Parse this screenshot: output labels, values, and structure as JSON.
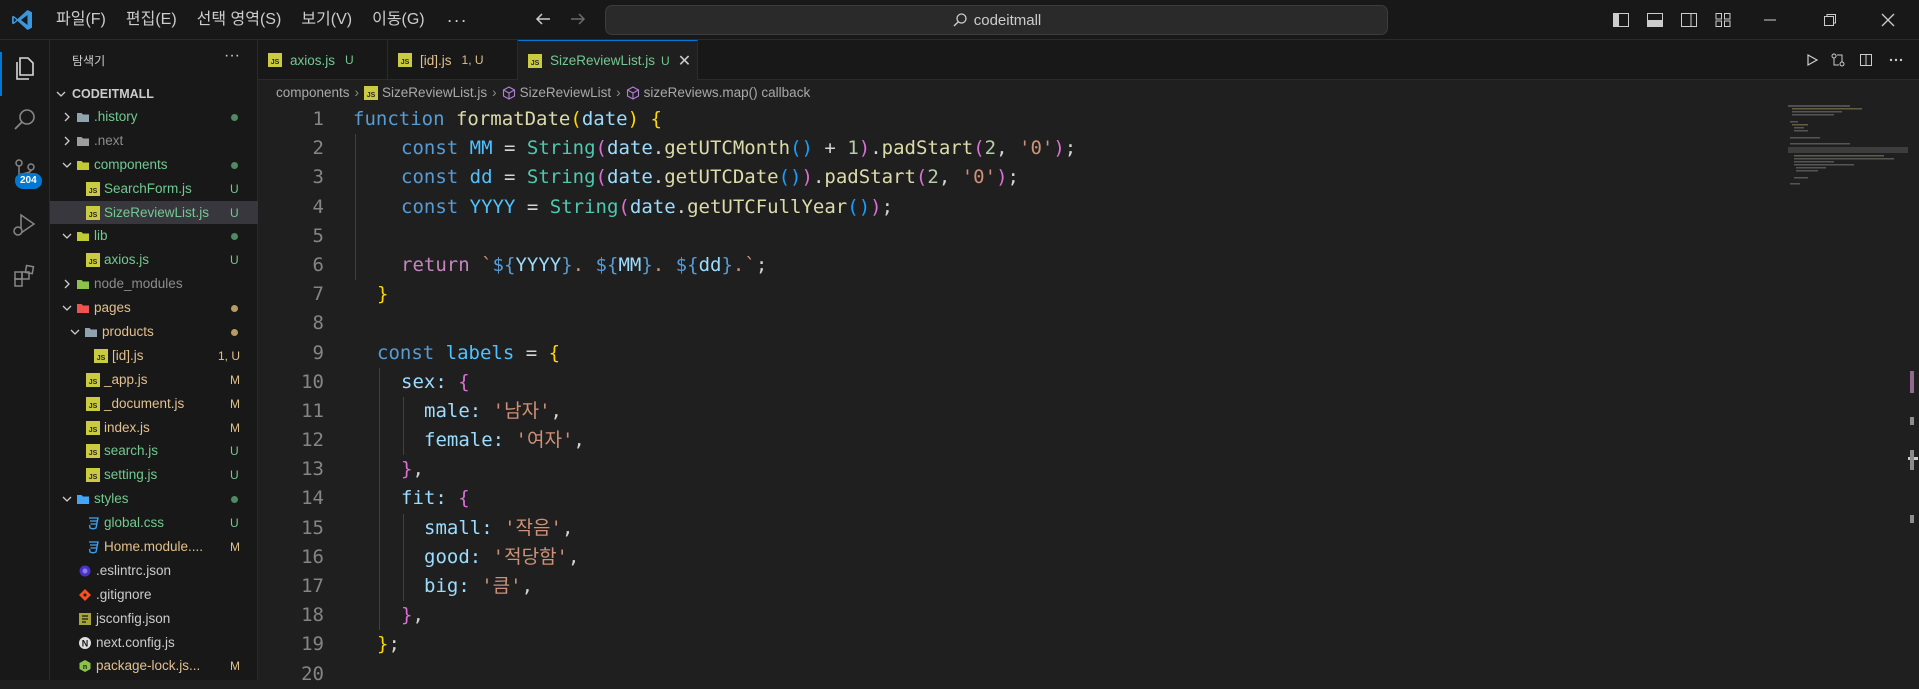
{
  "menu": [
    "파일(F)",
    "편집(E)",
    "선택 영역(S)",
    "보기(V)",
    "이동(G)"
  ],
  "menu_more": "···",
  "search": {
    "text": "codeitmall"
  },
  "activity": {
    "scm_badge": "204"
  },
  "explorer": {
    "title": "탐색기",
    "more": "···",
    "root": "CODEITMALL",
    "items": [
      {
        "name": ".history",
        "type": "folder",
        "status": "",
        "color": "green",
        "dot": true
      },
      {
        "name": ".next",
        "type": "folder",
        "status": "",
        "color": "gray",
        "dot": false
      },
      {
        "name": "components",
        "type": "folder",
        "status": "",
        "color": "green",
        "dot": true
      },
      {
        "name": "SearchForm.js",
        "type": "js",
        "status": "U",
        "color": "green",
        "dot": false
      },
      {
        "name": "SizeReviewList.js",
        "type": "js",
        "status": "U",
        "color": "green",
        "dot": false
      },
      {
        "name": "lib",
        "type": "folder",
        "status": "",
        "color": "green",
        "dot": true
      },
      {
        "name": "axios.js",
        "type": "js",
        "status": "U",
        "color": "green",
        "dot": false
      },
      {
        "name": "node_modules",
        "type": "folder",
        "status": "",
        "color": "gray",
        "dot": false
      },
      {
        "name": "pages",
        "type": "folder",
        "status": "",
        "color": "gold",
        "dot": true
      },
      {
        "name": "products",
        "type": "folder",
        "status": "",
        "color": "gold",
        "dot": true
      },
      {
        "name": "[id].js",
        "type": "js",
        "status": "1, U",
        "color": "gold",
        "dot": false
      },
      {
        "name": "_app.js",
        "type": "js",
        "status": "M",
        "color": "gold",
        "dot": false
      },
      {
        "name": "_document.js",
        "type": "js",
        "status": "M",
        "color": "gold",
        "dot": false
      },
      {
        "name": "index.js",
        "type": "js",
        "status": "M",
        "color": "gold",
        "dot": false
      },
      {
        "name": "search.js",
        "type": "js",
        "status": "U",
        "color": "green",
        "dot": false
      },
      {
        "name": "setting.js",
        "type": "js",
        "status": "U",
        "color": "green",
        "dot": false
      },
      {
        "name": "styles",
        "type": "folder",
        "status": "",
        "color": "green",
        "dot": true
      },
      {
        "name": "global.css",
        "type": "css",
        "status": "U",
        "color": "green",
        "dot": false
      },
      {
        "name": "Home.module....",
        "type": "css",
        "status": "M",
        "color": "gold",
        "dot": false
      },
      {
        "name": ".eslintrc.json",
        "type": "eslint",
        "status": "",
        "color": "default",
        "dot": false
      },
      {
        "name": ".gitignore",
        "type": "git",
        "status": "",
        "color": "default",
        "dot": false
      },
      {
        "name": "jsconfig.json",
        "type": "jsconfig",
        "status": "",
        "color": "default",
        "dot": false
      },
      {
        "name": "next.config.js",
        "type": "next",
        "status": "",
        "color": "default",
        "dot": false
      },
      {
        "name": "package-lock.js...",
        "type": "npm",
        "status": "M",
        "color": "gold",
        "dot": false
      }
    ]
  },
  "tabs": [
    {
      "label": "axios.js",
      "status": "U"
    },
    {
      "label": "[id].js",
      "status": "1, U"
    },
    {
      "label": "SizeReviewList.js",
      "status": "U",
      "close": "✕"
    }
  ],
  "breadcrumb": {
    "folder": "components",
    "file": "SizeReviewList.js",
    "symbol": "SizeReviewList",
    "callback": "sizeReviews.map() callback",
    "sep": "›"
  },
  "code": {
    "line_numbers": [
      "1",
      "2",
      "3",
      "4",
      "5",
      "6",
      "7",
      "8",
      "9",
      "10",
      "11",
      "12",
      "13",
      "14",
      "15",
      "16",
      "17",
      "18",
      "19",
      "20"
    ],
    "line1": {
      "kw": "function",
      "fn": "formatDate",
      "p": "(",
      "param": "date",
      "pc": ")",
      "brace": "{"
    },
    "line2": {
      "kw": "const",
      "name": "MM",
      "eq": "=",
      "cls": "String",
      "po": "(",
      "obj": "date",
      "dot": ".",
      "method": "getUTCMonth",
      "call": "()",
      "plus": "+",
      "one": "1",
      "pc": ")",
      "dot2": ".",
      "pad": "padStart",
      "po2": "(",
      "two": "2",
      "comma": ",",
      "zero": "'0'",
      "pc2": ")",
      "semi": ";"
    },
    "line3": {
      "kw": "const",
      "name": "dd",
      "eq": "=",
      "cls": "String",
      "po": "(",
      "obj": "date",
      "dot": ".",
      "method": "getUTCDate",
      "call": "()",
      "pc": ")",
      "dot2": ".",
      "pad": "padStart",
      "po2": "(",
      "two": "2",
      "comma": ",",
      "zero": "'0'",
      "pc2": ")",
      "semi": ";"
    },
    "line4": {
      "kw": "const",
      "name": "YYYY",
      "eq": "=",
      "cls": "String",
      "po": "(",
      "obj": "date",
      "dot": ".",
      "method": "getUTCFullYear",
      "call": "()",
      "pc": ")",
      "semi": ";"
    },
    "line6": {
      "kw": "return",
      "bt": "`",
      "d1": "${",
      "v1": "YYYY",
      "c1": "}",
      "t1": ". ",
      "d2": "${",
      "v2": "MM",
      "c2": "}",
      "t2": ". ",
      "d3": "${",
      "v3": "dd",
      "c3": "}",
      "t3": ".",
      "bt2": "`",
      "semi": ";"
    },
    "line7": {
      "brace": "}"
    },
    "line9": {
      "kw": "const",
      "name": "labels",
      "eq": "=",
      "brace": "{"
    },
    "line10": {
      "key": "sex",
      "colon": ":",
      "brace": "{"
    },
    "line11": {
      "key": "male",
      "colon": ":",
      "val": "'남자'",
      "comma": ","
    },
    "line12": {
      "key": "female",
      "colon": ":",
      "val": "'여자'",
      "comma": ","
    },
    "line13": {
      "brace": "}",
      "comma": ","
    },
    "line14": {
      "key": "fit",
      "colon": ":",
      "brace": "{"
    },
    "line15": {
      "key": "small",
      "colon": ":",
      "val": "'작음'",
      "comma": ","
    },
    "line16": {
      "key": "good",
      "colon": ":",
      "val": "'적당함'",
      "comma": ","
    },
    "line17": {
      "key": "big",
      "colon": ":",
      "val": "'큼'",
      "comma": ","
    },
    "line18": {
      "brace": "}",
      "comma": ","
    },
    "line19": {
      "brace": "}",
      "semi": ";"
    }
  },
  "colors": {
    "accent": "#0078d4",
    "git_untracked": "#73c991",
    "git_modified": "#e2c08d",
    "background": "#1f1f1f"
  }
}
